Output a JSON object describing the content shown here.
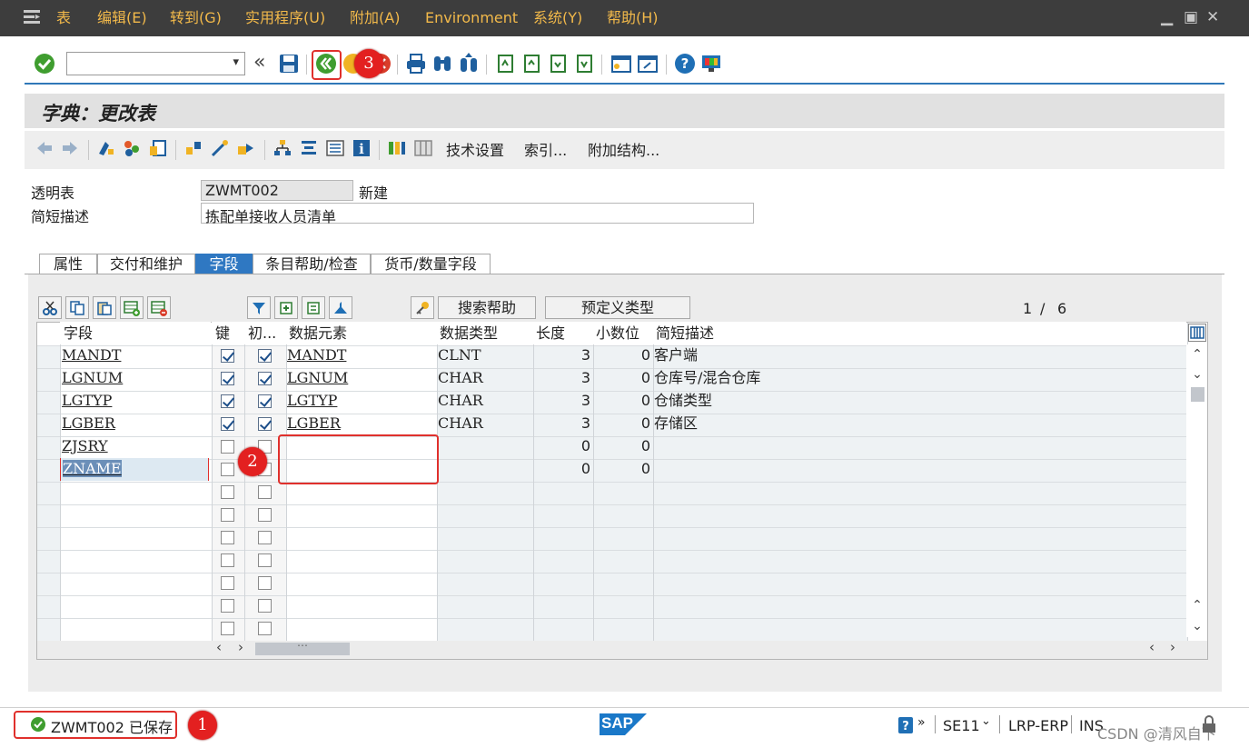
{
  "menubar": {
    "items": [
      "表",
      "编辑(E)",
      "转到(G)",
      "实用程序(U)",
      "附加(A)",
      "Environment",
      "系统(Y)",
      "帮助(H)"
    ],
    "window_controls": [
      "minimize-icon",
      "restore-icon",
      "close-icon"
    ]
  },
  "toolbar": {
    "command_field": "",
    "badge": "3"
  },
  "title": "字典：更改表",
  "app_toolbar": {
    "buttons": [
      "技术设置",
      "索引...",
      "附加结构..."
    ]
  },
  "header": {
    "table_label": "透明表",
    "table_name": "ZWMT002",
    "table_status": "新建",
    "desc_label": "简短描述",
    "desc_value": "拣配单接收人员清单"
  },
  "tabs": [
    "属性",
    "交付和维护",
    "字段",
    "条目帮助/检查",
    "货币/数量字段"
  ],
  "active_tab": "字段",
  "grid_toolbar": {
    "search_help": "搜索帮助",
    "predefined_type": "预定义类型",
    "page_current": "1",
    "page_sep": "/",
    "page_total": "6"
  },
  "table": {
    "columns": [
      "字段",
      "键",
      "初...",
      "数据元素",
      "数据类型",
      "长度",
      "小数位",
      "简短描述"
    ],
    "rows": [
      {
        "field": "MANDT",
        "key": true,
        "init": true,
        "element": "MANDT",
        "type": "CLNT",
        "length": "3",
        "decimals": "0",
        "desc": "客户端"
      },
      {
        "field": "LGNUM",
        "key": true,
        "init": true,
        "element": "LGNUM",
        "type": "CHAR",
        "length": "3",
        "decimals": "0",
        "desc": "仓库号/混合仓库"
      },
      {
        "field": "LGTYP",
        "key": true,
        "init": true,
        "element": "LGTYP",
        "type": "CHAR",
        "length": "3",
        "decimals": "0",
        "desc": "仓储类型"
      },
      {
        "field": "LGBER",
        "key": true,
        "init": true,
        "element": "LGBER",
        "type": "CHAR",
        "length": "3",
        "decimals": "0",
        "desc": "存储区"
      },
      {
        "field": "ZJSRY",
        "key": false,
        "init": false,
        "element": "",
        "type": "",
        "length": "0",
        "decimals": "0",
        "desc": ""
      },
      {
        "field": "ZNAME",
        "key": false,
        "init": false,
        "element": "",
        "type": "",
        "length": "0",
        "decimals": "0",
        "desc": ""
      }
    ],
    "badge": "2"
  },
  "statusbar": {
    "message": "ZWMT002 已保存",
    "badge": "1",
    "sap_logo": "SAP",
    "transaction": "SE11",
    "system": "LRP-ERP",
    "mode": "INS",
    "watermark": "CSDN @清风自下"
  },
  "colors": {
    "menu_bg": "#3d3d3d",
    "menu_text": "#f2b94a",
    "active_tab": "#2f78c2",
    "accent_line": "#2f78b8",
    "callout_red": "#e32020"
  }
}
